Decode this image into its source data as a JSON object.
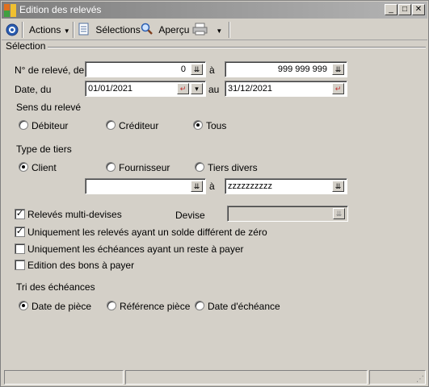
{
  "window": {
    "title": "Edition des relevés"
  },
  "toolbar": {
    "actions_label": "Actions",
    "selections_label": "Sélections",
    "preview_label": "Aperçu"
  },
  "selection": {
    "group_title": "Sélection",
    "releve_label": "N° de relevé, de",
    "releve_from": "0",
    "releve_to_sep": "à",
    "releve_to": "999 999 999",
    "date_label": "Date, du",
    "date_from": "01/01/2021",
    "date_to_sep": "au",
    "date_to": "31/12/2021",
    "sens_title": "Sens du relevé",
    "sens_options": [
      "Débiteur",
      "Créditeur",
      "Tous"
    ],
    "sens_selected": "Tous",
    "tiers_title": "Type de tiers",
    "tiers_options": [
      "Client",
      "Fournisseur",
      "Tiers divers"
    ],
    "tiers_selected": "Client",
    "tiers_from": "",
    "tiers_to_sep": "à",
    "tiers_to": "zzzzzzzzzz",
    "multi_devises_label": "Relevés multi-devises",
    "multi_devises_checked": true,
    "devise_label": "Devise",
    "devise_value": "",
    "solde_label": "Uniquement les relevés ayant un solde différent de zéro",
    "solde_checked": true,
    "reste_label": "Uniquement les échéances ayant un reste à payer",
    "reste_checked": false,
    "bons_label": "Edition des bons à payer",
    "bons_checked": false,
    "tri_title": "Tri des échéances",
    "tri_options": [
      "Date de pièce",
      "Référence pièce",
      "Date d'échéance"
    ],
    "tri_selected": "Date de pièce"
  },
  "colors": {
    "titlebar_start": "#7d7d7d",
    "titlebar_end": "#b5b5b5",
    "background": "#d4d0c8"
  }
}
